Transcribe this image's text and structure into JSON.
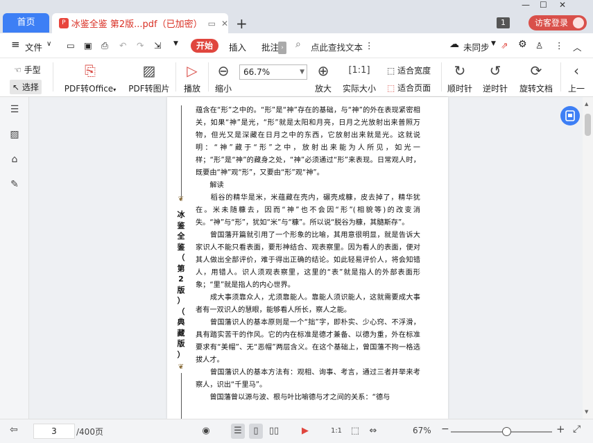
{
  "tabs": {
    "home": "首页",
    "doc": "冰鉴全鉴 第2版...pdf（已加密）",
    "pdf_badge": "P"
  },
  "title_badge": "1",
  "login": "访客登录",
  "menu": {
    "file": "文件",
    "start": "开始",
    "insert": "插入",
    "annotate": "批注",
    "search": "点此查找文本",
    "sync": "未同步"
  },
  "ribbon": {
    "hand": "手型",
    "select": "选择",
    "pdf_office": "PDF转Office",
    "pdf_img": "PDF转图片",
    "play": "播放",
    "zoom_out": "缩小",
    "zoom_value": "66.7%",
    "zoom_in": "放大",
    "actual": "实际大小",
    "fit_width": "适合宽度",
    "fit_page": "适合页面",
    "cw": "顺时针",
    "ccw": "逆时针",
    "rotate": "旋转文档",
    "prev": "上一"
  },
  "page": {
    "side_title": [
      "冰",
      "鉴",
      "全",
      "鉴",
      "（",
      "第",
      "2",
      "版",
      "）",
      "（",
      "典",
      "藏",
      "版",
      "）"
    ],
    "paragraphs": [
      "蕴含在“形”之中的。“形”是“神”存在的基础，与“神”的外在表现紧密相关，如果“神”是光，“形”就是太阳和月亮，日月之光放射出来普照万物，但光又是深藏在日月之中的东西，它放射出来就是光。这就说明：“神”藏于“形”之中，放射出来能为人所见，如光一样；“形”是“神”的藏身之处，“神”必须通过“形”来表现。日常观人时，既要由“神”观“形”，又要由“形”观“神”。",
      "　　解读",
      "　　稻谷的精华是米，米蕴藏在壳内，碾壳成糠，皮去掉了，精华犹在。米未随糠去，因而“神”也不会因“形”(相貌等)的改变消失。“神”与“形”，犹如“米”与“糠”。所以说“脱谷为糠，其髓斯存”。",
      "　　曾国藩开篇就引用了一个形象的比喻，其用意很明显，就是告诉大家识人不能只看表面，要形神结合、观表察里。因为看人的表面，便对其人做出全部评价，难于得出正确的结论。如此轻易评价人，将会知错人，用错人。识人须观表察里，这里的“表”就是指人的外部表面形象；“里”就是指人的内心世界。",
      "　　成大事须靠众人，尤须靠能人。靠能人须识能人，这就需要成大事者有一双识人的慧眼，能够看人所长，察人之能。",
      "　　曾国藩识人的基本原则是一个“拙”字，即朴实、少心窍、不浮滑，具有踏实苦干的作风。它的内在标准是德才兼备、以德为重，外在标准要求有“美帽”、无“恶帽”两层含义。在这个基础上，曾国藩不拘一格选拔人才。",
      "　　曾国藩识人的基本方法有：观相、询事、考言，通过三者并举来考察人，识出“千里马”。",
      "　　曾国藩曾以源与波、根与叶比喻德与才之间的关系：“德与"
    ]
  },
  "status": {
    "page_current": "3",
    "page_total": "/400页",
    "zoom": "67%"
  }
}
